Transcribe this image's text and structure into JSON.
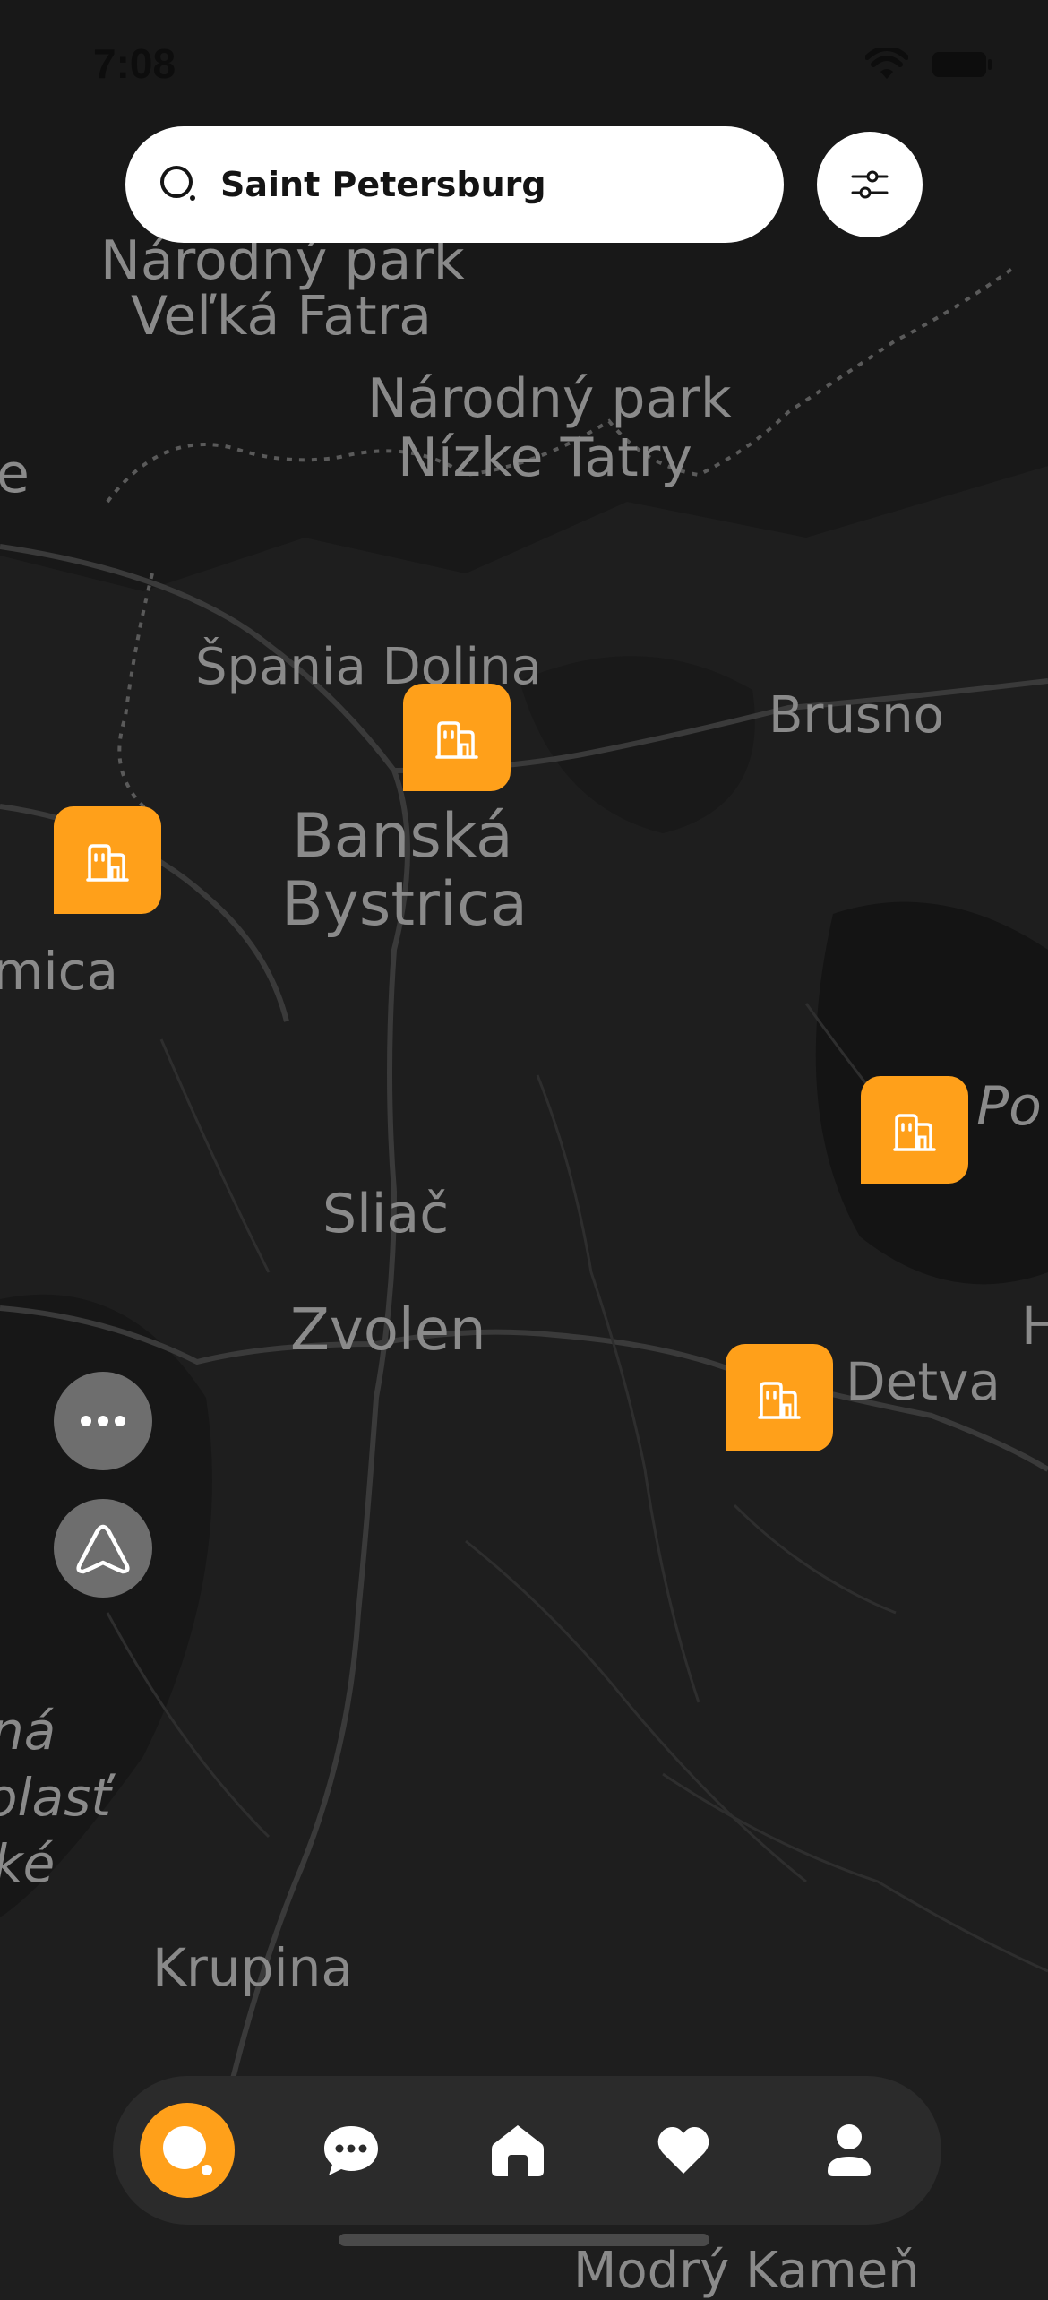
{
  "status": {
    "time": "7:08"
  },
  "search": {
    "value": "Saint Petersburg"
  },
  "map_labels": {
    "narodny_park_1": "Národný park",
    "velka_fatra": "Veľká Fatra",
    "narodny_park_2": "Národný park",
    "nizke_tatry": "Nízke Tatry",
    "spania_dolina": "Špania Dolina",
    "brusno": "Brusno",
    "banska": "Banská",
    "bystrica": "Bystrica",
    "mica": "mica",
    "sliac": "Sliač",
    "zolen": "Zvolen",
    "detva": "Detva",
    "krupina": "Krupina",
    "edge_e": "e",
    "edge_po": "Po",
    "edge_h": "H",
    "edge_na": "ná",
    "edge_olast": "olasť",
    "edge_ke": "ké",
    "edge_bottom": "Modrý Kameň"
  },
  "markers": [
    {
      "name": "hotel-marker-spania-dolina",
      "icon": "building-icon"
    },
    {
      "name": "hotel-marker-west",
      "icon": "building-icon"
    },
    {
      "name": "hotel-marker-east",
      "icon": "building-icon"
    },
    {
      "name": "hotel-marker-detva",
      "icon": "building-icon"
    }
  ],
  "tabs": [
    {
      "name": "search",
      "icon": "search-icon",
      "active": true
    },
    {
      "name": "messages",
      "icon": "chat-icon",
      "active": false
    },
    {
      "name": "home",
      "icon": "home-icon",
      "active": false
    },
    {
      "name": "favorites",
      "icon": "heart-icon",
      "active": false
    },
    {
      "name": "profile",
      "icon": "user-icon",
      "active": false
    }
  ],
  "colors": {
    "accent": "#ffa01a",
    "map_background": "#1e1e1e",
    "tabbar_background": "#2b2b2b"
  }
}
